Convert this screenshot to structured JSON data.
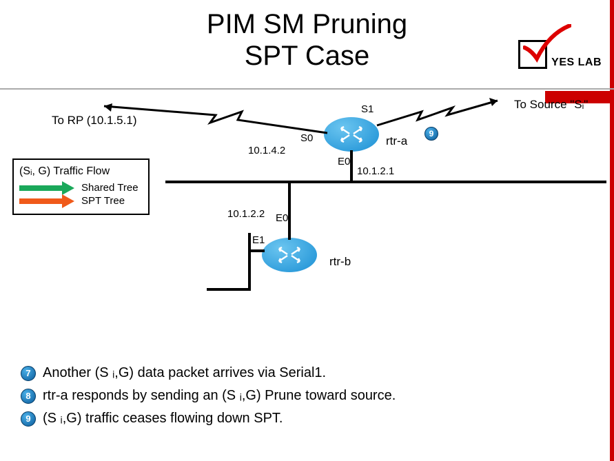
{
  "title_line1": "PIM SM Pruning",
  "title_line2": "SPT Case",
  "logo": {
    "text": "YES LAB"
  },
  "legend": {
    "title": "(Sᵢ, G) Traffic Flow",
    "shared_label": "Shared Tree",
    "spt_label": "SPT Tree",
    "shared_color": "#1aa85a",
    "spt_color": "#f05a1a"
  },
  "diagram": {
    "to_rp": "To RP (10.1.5.1)",
    "to_source": "To Source \"Sᵢ\"",
    "rtr_a": "rtr-a",
    "rtr_b": "rtr-b",
    "s0": "S0",
    "s1": "S1",
    "e0_a": "E0",
    "e0_b": "E0",
    "e1": "E1",
    "ip_s0": "10.1.4.2",
    "ip_e0a": "10.1.2.1",
    "ip_e0b": "10.1.2.2",
    "badge9": "9"
  },
  "notes": {
    "n7": {
      "num": "7",
      "text": "Another (S ᵢ,G) data packet arrives via Serial1."
    },
    "n8": {
      "num": "8",
      "text": "rtr-a responds by sending an (S ᵢ,G) Prune toward source."
    },
    "n9": {
      "num": "9",
      "text": "(S ᵢ,G) traffic ceases flowing down SPT."
    }
  }
}
